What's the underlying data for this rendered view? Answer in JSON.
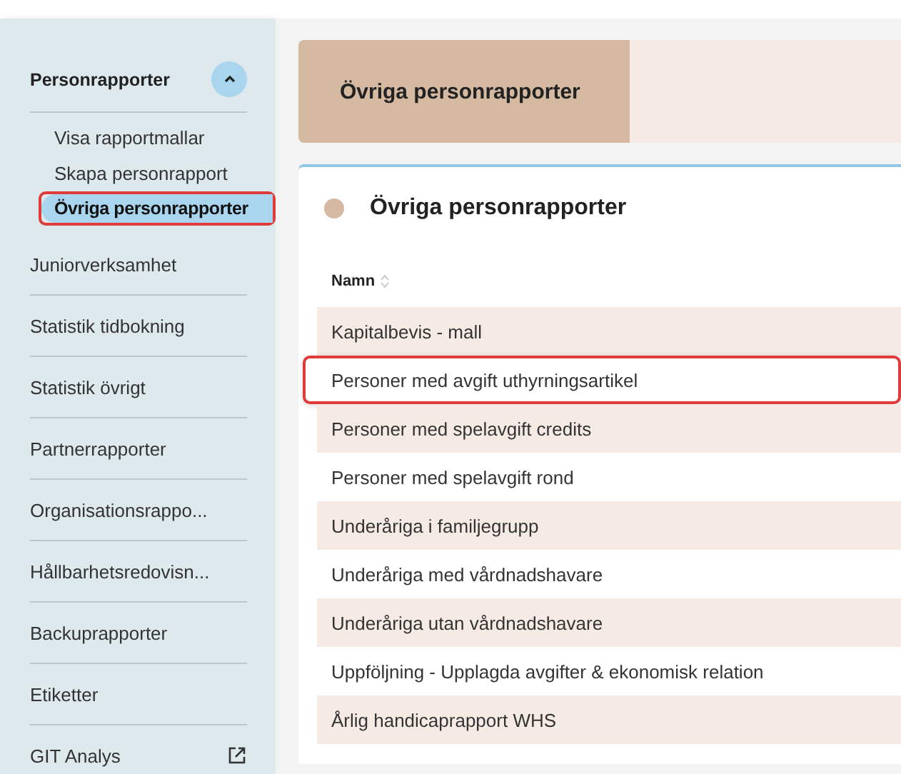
{
  "sidebar": {
    "group": {
      "label": "Personrapporter",
      "expanded": true,
      "children": [
        {
          "label": "Visa rapportmallar",
          "selected": false,
          "highlighted": false
        },
        {
          "label": "Skapa personrapport",
          "selected": false,
          "highlighted": false
        },
        {
          "label": "Övriga personrapporter",
          "selected": true,
          "highlighted": true
        }
      ]
    },
    "items": [
      {
        "label": "Juniorverksamhet",
        "external": false
      },
      {
        "label": "Statistik tidbokning",
        "external": false
      },
      {
        "label": "Statistik övrigt",
        "external": false
      },
      {
        "label": "Partnerrapporter",
        "external": false
      },
      {
        "label": "Organisationsrappo...",
        "external": false
      },
      {
        "label": "Hållbarhetsredovisn...",
        "external": false
      },
      {
        "label": "Backuprapporter",
        "external": false
      },
      {
        "label": "Etiketter",
        "external": false
      },
      {
        "label": "GIT Analys",
        "external": true
      }
    ]
  },
  "header": {
    "title": "Övriga personrapporter"
  },
  "card": {
    "title": "Övriga personrapporter",
    "table": {
      "columns": [
        {
          "label": "Namn",
          "sortable": true
        }
      ],
      "rows": [
        {
          "name": "Kapitalbevis - mall",
          "highlighted": false
        },
        {
          "name": "Personer med avgift uthyrningsartikel",
          "highlighted": true
        },
        {
          "name": "Personer med spelavgift credits",
          "highlighted": false
        },
        {
          "name": "Personer med spelavgift rond",
          "highlighted": false
        },
        {
          "name": "Underåriga i familjegrupp",
          "highlighted": false
        },
        {
          "name": "Underåriga med vårdnadshavare",
          "highlighted": false
        },
        {
          "name": "Underåriga utan vårdnadshavare",
          "highlighted": false
        },
        {
          "name": "Uppföljning - Upplagda avgifter & ekonomisk relation",
          "highlighted": false
        },
        {
          "name": "Årlig handicaprapport WHS",
          "highlighted": false
        }
      ]
    }
  }
}
